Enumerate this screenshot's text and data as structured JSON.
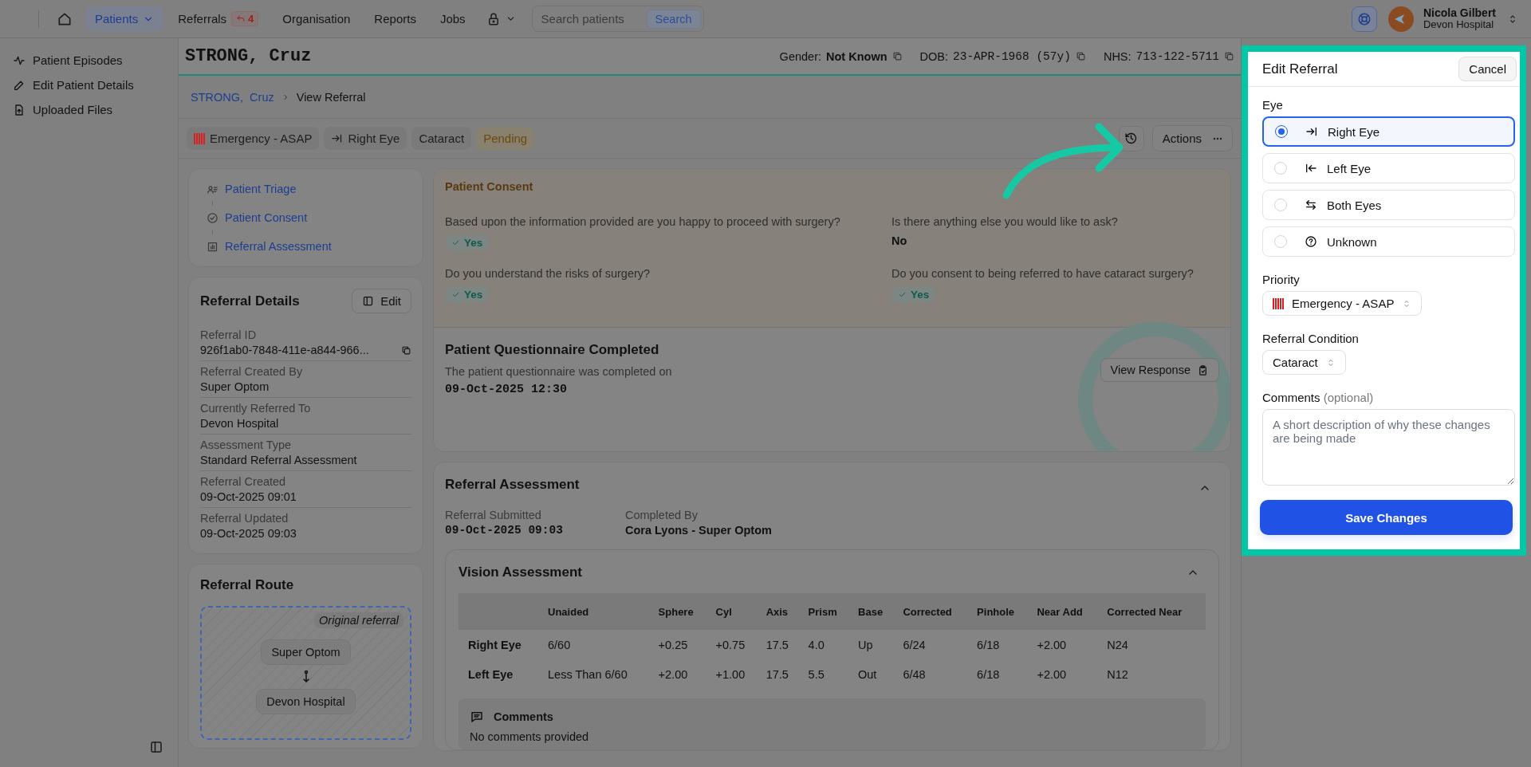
{
  "nav": {
    "items": [
      {
        "label": "Patients",
        "selected": true,
        "kind": "dropdown"
      },
      {
        "label": "Referrals",
        "selected": false,
        "kind": "count",
        "count": "4"
      },
      {
        "label": "Organisation",
        "selected": false,
        "kind": "plain"
      },
      {
        "label": "Reports",
        "selected": false,
        "kind": "plain"
      },
      {
        "label": "Jobs",
        "selected": false,
        "kind": "plain"
      }
    ],
    "search": {
      "placeholder": "Search patients",
      "button": "Search"
    },
    "user": {
      "name": "Nicola Gilbert",
      "org": "Devon Hospital"
    }
  },
  "sidebar": {
    "items": [
      {
        "label": "Patient Episodes",
        "kind": "activity"
      },
      {
        "label": "Edit Patient Details",
        "kind": "pencil"
      },
      {
        "label": "Uploaded Files",
        "kind": "file"
      }
    ]
  },
  "patient": {
    "name": "STRONG, Cruz",
    "info": [
      {
        "label": "Gender:",
        "value": "Not Known",
        "kind": "text"
      },
      {
        "label": "DOB:",
        "value": "23-APR-1968 (57y)",
        "kind": "code"
      },
      {
        "label": "NHS:",
        "value": "713-122-5711",
        "kind": "code"
      }
    ]
  },
  "breadcrumb": {
    "parent": "STRONG,  Cruz",
    "current": "View Referral"
  },
  "tags": [
    {
      "label": "Emergency - ASAP",
      "kind": "priority"
    },
    {
      "label": "Right Eye",
      "kind": "eye"
    },
    {
      "label": "Cataract",
      "kind": "plain"
    },
    {
      "label": "Pending",
      "kind": "status"
    }
  ],
  "actions_button": "Actions",
  "steps": [
    {
      "label": "Patient Triage",
      "kind": "triage"
    },
    {
      "label": "Patient Consent",
      "kind": "consent"
    },
    {
      "label": "Referral Assessment",
      "kind": "assessment"
    }
  ],
  "referral_details": {
    "title": "Referral Details",
    "edit_button": "Edit",
    "fields": [
      {
        "label": "Referral ID",
        "value": "926f1ab0-7848-411e-a844-966...",
        "copyable": true
      },
      {
        "label": "Referral Created By",
        "value": "Super Optom",
        "copyable": false
      },
      {
        "label": "Currently Referred To",
        "value": "Devon Hospital",
        "copyable": false
      },
      {
        "label": "Assessment Type",
        "value": "Standard Referral Assessment",
        "copyable": false
      },
      {
        "label": "Referral Created",
        "value": "09-Oct-2025 09:01",
        "copyable": false
      },
      {
        "label": "Referral Updated",
        "value": "09-Oct-2025 09:03",
        "copyable": false
      }
    ]
  },
  "referral_route": {
    "title": "Referral Route",
    "tag": "Original referral",
    "nodes": [
      "Super Optom",
      "Devon Hospital"
    ]
  },
  "consent": {
    "title": "Patient Consent",
    "questions": [
      {
        "question": "Based upon the information provided are you happy to proceed with surgery?",
        "answer": "Yes",
        "kind": "badge"
      },
      {
        "question": "Do you understand the risks of surgery?",
        "answer": "Yes",
        "kind": "badge"
      },
      {
        "question": "Is there anything else you would like to ask?",
        "answer": "No",
        "kind": "text"
      },
      {
        "question": "Do you consent to being referred to have cataract surgery?",
        "answer": "Yes",
        "kind": "badge"
      }
    ]
  },
  "questionnaire": {
    "title": "Patient Questionnaire Completed",
    "text": "The patient questionnaire was completed on",
    "date": "09-Oct-2025 12:30",
    "button": "View Response"
  },
  "assessment": {
    "title": "Referral Assessment",
    "expanded": true,
    "fields": [
      {
        "label": "Referral Submitted",
        "value": "09-Oct-2025 09:03",
        "kind": "code"
      },
      {
        "label": "Completed By",
        "value": "Cora Lyons - Super Optom",
        "kind": "text"
      }
    ],
    "vision": {
      "title": "Vision Assessment",
      "expanded": true,
      "columns": [
        "Unaided",
        "Sphere",
        "Cyl",
        "Axis",
        "Prism",
        "Base",
        "Corrected",
        "Pinhole",
        "Near Add",
        "Corrected Near"
      ],
      "rows": [
        {
          "eye": "Right Eye",
          "values": [
            "6/60",
            "+0.25",
            "+0.75",
            "17.5",
            "4.0",
            "Up",
            "6/24",
            "6/18",
            "+2.00",
            "N24"
          ]
        },
        {
          "eye": "Left Eye",
          "values": [
            "Less Than 6/60",
            "+2.00",
            "+1.00",
            "17.5",
            "5.5",
            "Out",
            "6/48",
            "6/18",
            "+2.00",
            "N12"
          ]
        }
      ],
      "comments": {
        "title": "Comments",
        "text": "No comments provided"
      }
    }
  },
  "edit_referral": {
    "title": "Edit Referral",
    "cancel": "Cancel",
    "eye_label": "Eye",
    "eye_options": [
      {
        "label": "Right Eye",
        "kind": "right",
        "selected": true
      },
      {
        "label": "Left Eye",
        "kind": "left",
        "selected": false
      },
      {
        "label": "Both Eyes",
        "kind": "both",
        "selected": false
      },
      {
        "label": "Unknown",
        "kind": "unknown",
        "selected": false
      }
    ],
    "priority_label": "Priority",
    "priority": "Emergency - ASAP",
    "condition_label": "Referral Condition",
    "condition": "Cataract",
    "comments_label": "Comments",
    "comments_hint": "(optional)",
    "comments": {
      "placeholder": "A short description of why these changes are being made"
    },
    "save_button": "Save Changes"
  }
}
